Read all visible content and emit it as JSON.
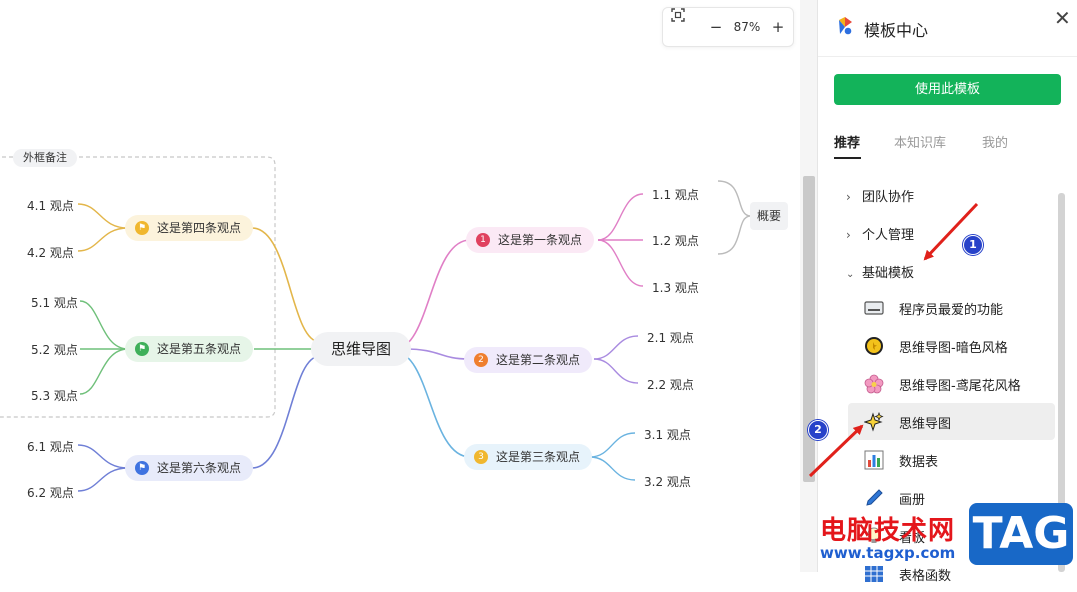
{
  "mindmap": {
    "root": "思维导图",
    "frame_label": "外框备注",
    "summary": "概要",
    "branches": [
      {
        "label": "这是第一条观点",
        "marker": "1",
        "children": [
          "1.1 观点",
          "1.2 观点",
          "1.3 观点"
        ]
      },
      {
        "label": "这是第二条观点",
        "marker": "2",
        "children": [
          "2.1 观点",
          "2.2 观点"
        ]
      },
      {
        "label": "这是第三条观点",
        "marker": "3",
        "children": [
          "3.1 观点",
          "3.2 观点"
        ]
      },
      {
        "label": "这是第四条观点",
        "marker": "flag-icon",
        "children": [
          "4.1 观点",
          "4.2 观点"
        ]
      },
      {
        "label": "这是第五条观点",
        "marker": "flag-icon",
        "children": [
          "5.1 观点",
          "5.2 观点",
          "5.3 观点"
        ]
      },
      {
        "label": "这是第六条观点",
        "marker": "flag-icon",
        "children": [
          "6.1 观点",
          "6.2 观点"
        ]
      }
    ],
    "colors": {
      "b1": "#e07fc6",
      "b2": "#a98be0",
      "b3": "#6ab3e0",
      "b4": "#e3b64a",
      "b5": "#6fc07a",
      "b6": "#6f7fd6"
    }
  },
  "zoom": {
    "fit_icon": "fit-screen-icon",
    "minus": "−",
    "value": "87%",
    "plus": "+"
  },
  "panel": {
    "title": "模板中心",
    "close": "✕",
    "use_button": "使用此模板",
    "tabs": [
      "推荐",
      "本知识库",
      "我的"
    ],
    "groups": [
      {
        "label": "团队协作",
        "expanded": false
      },
      {
        "label": "个人管理",
        "expanded": false
      },
      {
        "label": "基础模板",
        "expanded": true
      }
    ],
    "templates": [
      {
        "label": "程序员最爱的功能",
        "icon": "keyboard-icon"
      },
      {
        "label": "思维导图-暗色风格",
        "icon": "moon-icon"
      },
      {
        "label": "思维导图-鸢尾花风格",
        "icon": "flower-icon"
      },
      {
        "label": "思维导图",
        "icon": "sparkle-icon",
        "selected": true
      },
      {
        "label": "数据表",
        "icon": "bar-chart-icon"
      },
      {
        "label": "画册",
        "icon": "pen-icon"
      },
      {
        "label": "看板",
        "icon": "bulb-icon"
      },
      {
        "label": "表格函数",
        "icon": "table-icon"
      }
    ]
  },
  "annotations": {
    "badge1": "1",
    "badge2": "2"
  },
  "watermark": {
    "text": "电脑技术网",
    "url": "www.tagxp.com",
    "tag": "TAG"
  }
}
